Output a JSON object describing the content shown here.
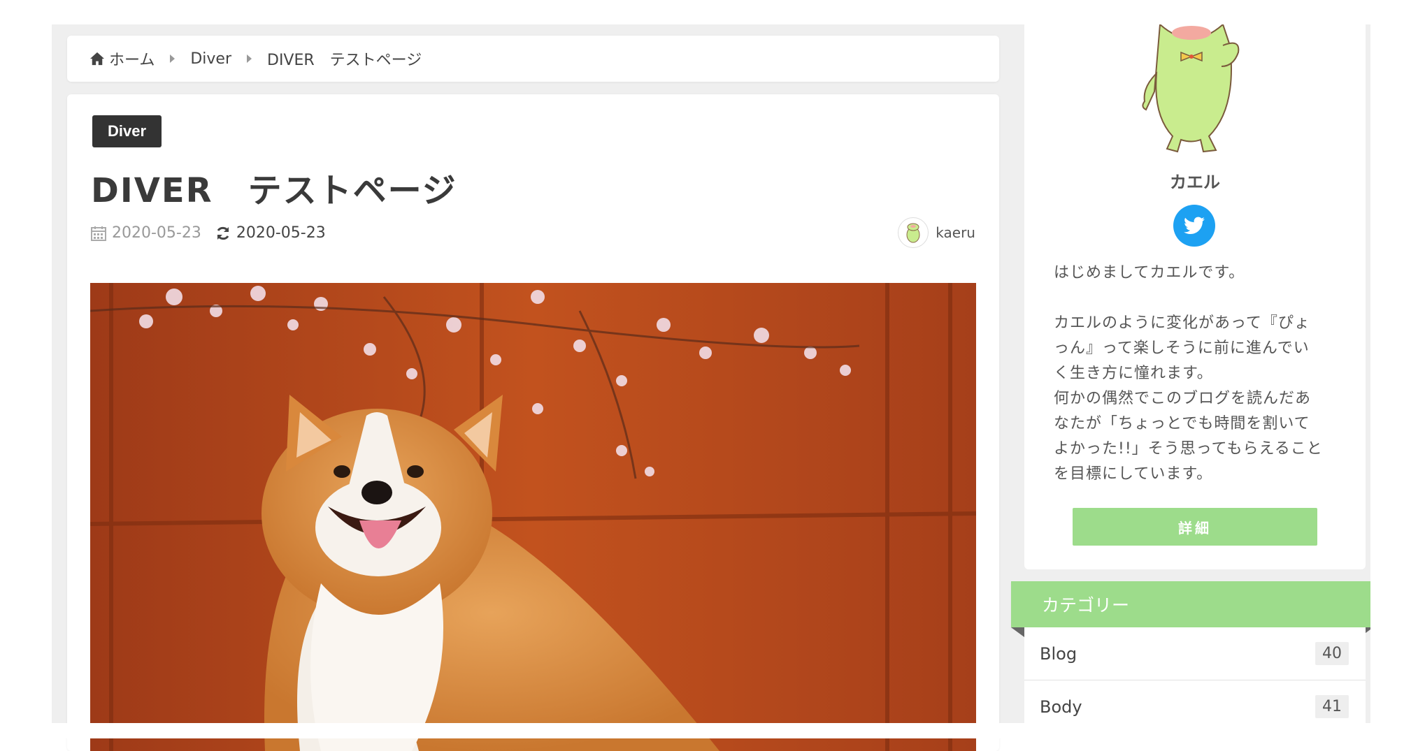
{
  "breadcrumb": {
    "items": [
      "ホーム",
      "Diver",
      "DIVER　テストページ"
    ]
  },
  "article": {
    "category": "Diver",
    "title": "DIVER　テストページ",
    "published": "2020-05-23",
    "updated": "2020-05-23",
    "author": "kaeru",
    "hero_image": "corgi-photo"
  },
  "profile": {
    "name": "カエル",
    "bio": "はじめましてカエルです。\n\nカエルのように変化があって『ぴょ\nっん』って楽しそうに前に進んでい\nく生き方に憧れます。\n何かの偶然でこのブログを読んだあ\nなたが「ちょっとでも時間を割いて\nよかった!!」そう思ってもらえること\nを目標にしています。",
    "detail_label": "詳細"
  },
  "categories": {
    "header": "カテゴリー",
    "items": [
      {
        "name": "Blog",
        "count": "40"
      },
      {
        "name": "Body",
        "count": "41"
      }
    ]
  },
  "colors": {
    "accent_green": "#9ddc8b",
    "twitter_blue": "#1da1f2",
    "badge_dark": "#333333"
  }
}
